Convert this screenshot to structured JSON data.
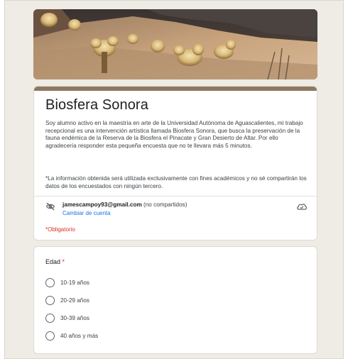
{
  "form": {
    "title": "Biosfera Sonora",
    "description": "Soy alumno activo en  la maestría en arte de la Universidad Autónoma de Aguascalientes, mi trabajo recepcional es una intervención artística llamada Biosfera Sonora, que  busca la preservación de la fauna endémica de la Reserva de la Biosfera el Pinacate y Gran Desierto de Altar. Por ello agradecería responder esta pequeña encuesta que no te llevara más 5 minutos.",
    "note": "*La información obtenida será utilizada exclusivamente con fines académicos y no sé compartirán los datos de los encuestados con ningún tercero.",
    "account": {
      "email": "jamescampoy93@gmail.com",
      "shared_note": "(no compartidos)",
      "switch_label": "Cambiar de cuenta",
      "hidden_icon": "eye-off-icon",
      "cloud_icon": "cloud-icon"
    },
    "required_label": "*Obligatorio",
    "accent_color": "#8e785f",
    "background_color": "#efebe5"
  },
  "question": {
    "label": "Edad",
    "required_mark": "*",
    "options": [
      "10-19 años",
      "20-29 años",
      "30-39 años",
      "40 años y más"
    ]
  }
}
